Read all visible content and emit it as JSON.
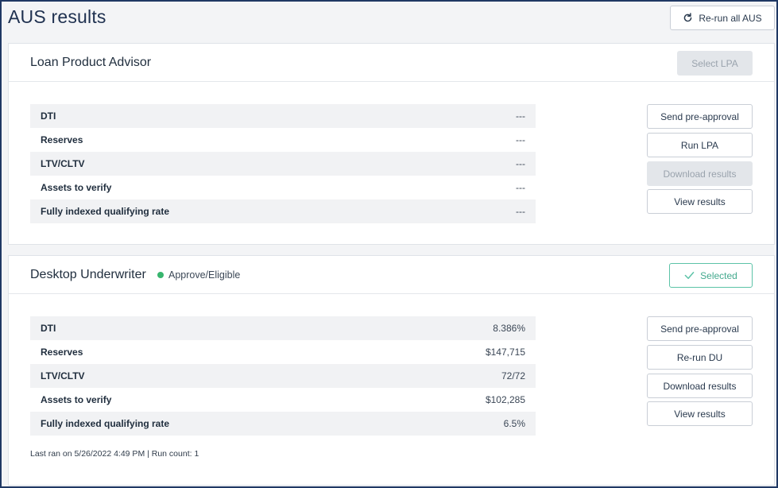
{
  "page": {
    "title": "AUS results",
    "rerun_all_label": "Re-run all AUS"
  },
  "lpa": {
    "title": "Loan Product Advisor",
    "select_label": "Select LPA",
    "metrics": [
      {
        "label": "DTI",
        "value": "---"
      },
      {
        "label": "Reserves",
        "value": "---"
      },
      {
        "label": "LTV/CLTV",
        "value": "---"
      },
      {
        "label": "Assets to verify",
        "value": "---"
      },
      {
        "label": "Fully indexed qualifying rate",
        "value": "---"
      }
    ],
    "actions": {
      "send_preapproval": "Send pre-approval",
      "run": "Run LPA",
      "download": "Download results",
      "view": "View results"
    }
  },
  "du": {
    "title": "Desktop Underwriter",
    "status": "Approve/Eligible",
    "status_color": "#38b56e",
    "selected_label": "Selected",
    "metrics": [
      {
        "label": "DTI",
        "value": "8.386%"
      },
      {
        "label": "Reserves",
        "value": "$147,715"
      },
      {
        "label": "LTV/CLTV",
        "value": "72/72"
      },
      {
        "label": "Assets to verify",
        "value": "$102,285"
      },
      {
        "label": "Fully indexed qualifying rate",
        "value": "6.5%"
      }
    ],
    "actions": {
      "send_preapproval": "Send pre-approval",
      "run": "Re-run DU",
      "download": "Download results",
      "view": "View results"
    },
    "last_ran": "Last ran on 5/26/2022 4:49 PM | Run count: 1"
  }
}
